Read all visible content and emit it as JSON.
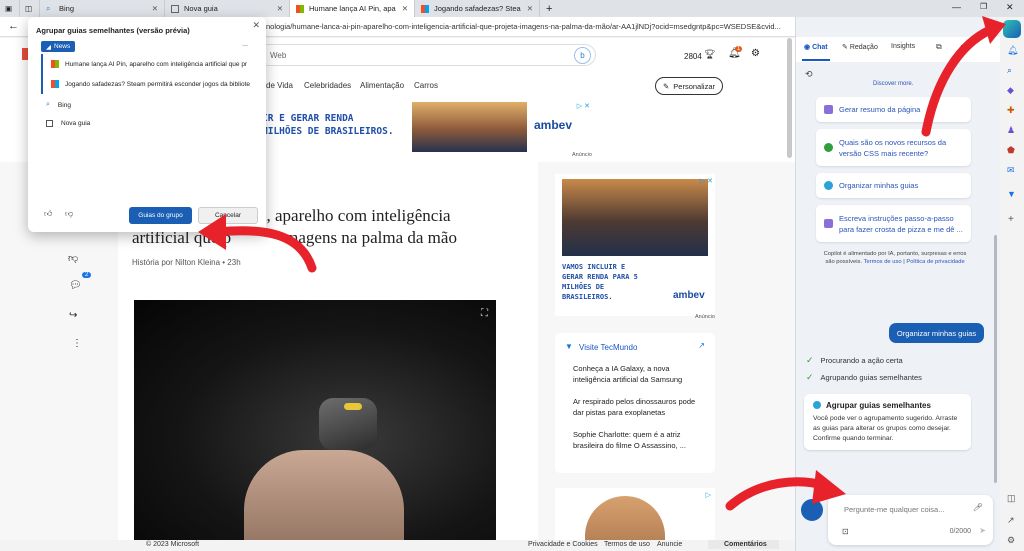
{
  "tabs": [
    {
      "label": "Bing"
    },
    {
      "label": "Nova guia"
    },
    {
      "label": "Humane lança AI Pin, aparelho c"
    },
    {
      "label": "Jogando safadezas? Steam perm"
    }
  ],
  "address": {
    "url": "nologia/humane-lanca-ai-pin-aparelho-com-inteligencia-artificial-que-projeta-imagens-na-palma-da-mão/ar-AA1jlNDj?ocid=msedgntp&pc=WSEDSE&cvid..."
  },
  "site": {
    "search_placeholder": "Web",
    "points": "2804",
    "notif_count": "1",
    "personalize": "Personalizar",
    "nav": [
      "de Vida",
      "Celebridades",
      "Alimentação",
      "Carros"
    ]
  },
  "ad1": {
    "text": "IR E GERAR RENDA\nMILHÕES DE BRASILEIROS.",
    "brand": "ambev",
    "label": "Anúncio"
  },
  "article": {
    "title_line1": "n, aparelho com inteligência",
    "title_line2": "artificial que p",
    "title_line2b": "magens na palma da mão",
    "byline": "História por Nilton Kleina",
    "age": "23h",
    "comments": "2"
  },
  "ad2": {
    "text": "VAMOS INCLUIR E GERAR RENDA PARA 5 MILHÕES DE BRASILEIROS.",
    "brand": "ambev",
    "label": "Anúncio"
  },
  "tecmundo": {
    "title": "Visite TecMundo",
    "items": [
      "Conheça a IA Galaxy, a nova inteligência artificial da Samsung",
      "Ar respirado pelos dinossauros pode dar pistas para exoplanetas",
      "Sophie Charlotte: quem é a atriz brasileira do filme O Assassino, ..."
    ]
  },
  "footer": {
    "copyright": "© 2023 Microsoft",
    "privacy": "Privacidade e Cookies",
    "terms": "Termos de uso",
    "ads": "Anuncie",
    "comments": "Comentários"
  },
  "popup": {
    "title": "Agrupar guias semelhantes (versão prévia)",
    "group_label": "News",
    "group_tabs": [
      "Humane lança AI Pin, aparelho com inteligência artificial que pr",
      "Jogando safadezas? Steam permitirá esconder jogos da bibliote"
    ],
    "loose_tabs": [
      "Bing",
      "Nova guia"
    ],
    "group_btn": "Guias do grupo",
    "cancel_btn": "Cancelar",
    "more": "..."
  },
  "copilot": {
    "tabs": [
      "Chat",
      "Redação",
      "Insights"
    ],
    "discover": "Discover more.",
    "suggestions": [
      "Gerar resumo da página",
      "Quais são os novos recursos da versão CSS mais recente?",
      "Organizar minhas guias",
      "Escreva instruções passo-a-passo para fazer crosta de pizza e me dê ..."
    ],
    "disclaimer": "Copilot é alimentado por IA, portanto, surpresas e erros são possíveis.",
    "terms": "Termos de uso",
    "privacy": "Política de privacidade",
    "user_msg": "Organizar minhas guias",
    "steps": [
      "Procurando a ação certa",
      "Agrupando guias semelhantes"
    ],
    "result_title": "Agrupar guias semelhantes",
    "result_body": "Você pode ver o agrupamento sugerido. Arraste as guias para alterar os grupos como desejar. Confirme quando terminar.",
    "input_placeholder": "Pergunte-me qualquer coisa...",
    "counter": "0/2000"
  },
  "colors": {
    "accent": "#1a5fb4",
    "arrow": "#e8222b",
    "green": "#2e9e3f"
  }
}
